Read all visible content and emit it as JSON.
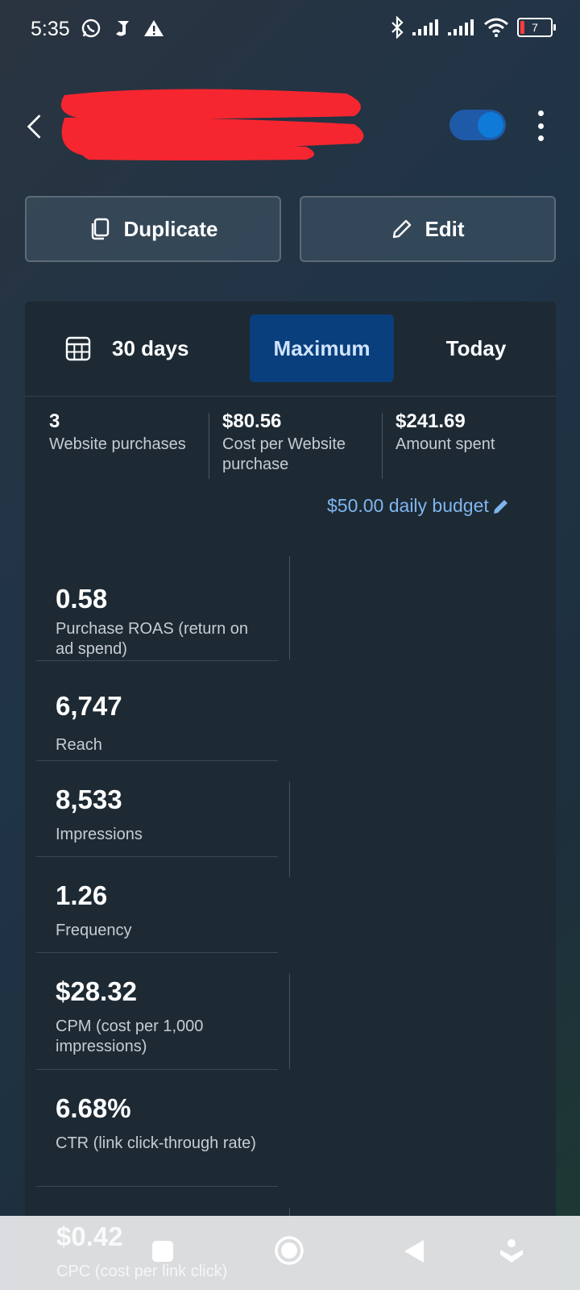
{
  "status": {
    "time": "5:35",
    "battery": "7"
  },
  "actions": {
    "duplicate": "Duplicate",
    "edit": "Edit"
  },
  "tabs": {
    "range30": "30 days",
    "maximum": "Maximum",
    "today": "Today"
  },
  "summary": [
    {
      "value": "3",
      "label": "Website purchases"
    },
    {
      "value": "$80.56",
      "label": "Cost per Website purchase"
    },
    {
      "value": "$241.69",
      "label": "Amount spent"
    }
  ],
  "budget": "$50.00 daily budget",
  "metrics": [
    {
      "value": "0.58",
      "label": "Purchase ROAS (return on ad spend)"
    },
    {
      "value": "6,747",
      "label": "Reach"
    },
    {
      "value": "8,533",
      "label": "Impressions"
    },
    {
      "value": "1.26",
      "label": "Frequency"
    },
    {
      "value": "$28.32",
      "label": "CPM (cost per 1,000 impressions)"
    },
    {
      "value": "6.68%",
      "label": "CTR (link click-through rate)"
    },
    {
      "value": "$0.42",
      "label": "CPC (cost per link click)"
    }
  ],
  "colors": {
    "accent": "#0a3f7d",
    "link": "#7fb5ee",
    "toggle": "#0f7ad8",
    "card": "#1d2a34",
    "redaction": "#f5262f"
  }
}
